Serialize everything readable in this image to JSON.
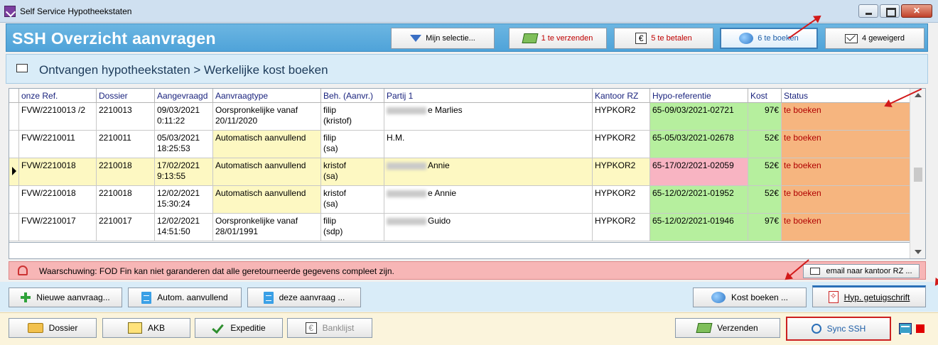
{
  "window": {
    "title": "Self Service Hypotheekstaten"
  },
  "header": {
    "title": "SSH  Overzicht aanvragen",
    "buttons": [
      {
        "label": "Mijn selectie...",
        "icon": "funnel-icon"
      },
      {
        "label": "1 te verzenden",
        "icon": "money-icon"
      },
      {
        "label": "5 te betalen",
        "icon": "euro-icon"
      },
      {
        "label": "6 te boeken",
        "icon": "gem-icon"
      },
      {
        "label": "4 geweigerd",
        "icon": "envelope-icon"
      }
    ]
  },
  "breadcrumb": "Ontvangen hypotheekstaten > Werkelijke kost boeken",
  "table": {
    "columns": [
      "onze Ref.",
      "Dossier",
      "Aangevraagd",
      "Aanvraagtype",
      "Beh. (Aanvr.)",
      "Partij 1",
      "Kantoor RZ",
      "Hypo-referentie",
      "Kost",
      "Status"
    ],
    "rows": [
      {
        "ref": "FVW/2210013 /2",
        "dossier": "2210013",
        "date": "09/03/2021",
        "time": "0:11:22",
        "type1": "Oorspronkelijke vanaf",
        "type2": "20/11/2020",
        "beh1": "filip",
        "beh2": "(kristof)",
        "partij": "e Marlies",
        "kantoor": "HYPKOR2",
        "hypo": "65-09/03/2021-02721",
        "kost": "97€",
        "status": "te boeken"
      },
      {
        "ref": "FVW/2210011",
        "dossier": "2210011",
        "date": "05/03/2021",
        "time": "18:25:53",
        "type1": "Automatisch aanvullend",
        "type2": "",
        "beh1": "filip",
        "beh2": "(sa)",
        "partij": "H.M.",
        "kantoor": "HYPKOR2",
        "hypo": "65-05/03/2021-02678",
        "kost": "52€",
        "status": "te boeken"
      },
      {
        "ref": "FVW/2210018",
        "dossier": "2210018",
        "date": "17/02/2021",
        "time": "9:13:55",
        "type1": "Automatisch aanvullend",
        "type2": "",
        "beh1": "kristof",
        "beh2": "(sa)",
        "partij": "Annie",
        "kantoor": "HYPKOR2",
        "hypo": "65-17/02/2021-02059",
        "kost": "52€",
        "status": "te boeken"
      },
      {
        "ref": "FVW/2210018",
        "dossier": "2210018",
        "date": "12/02/2021",
        "time": "15:30:24",
        "type1": "Automatisch aanvullend",
        "type2": "",
        "beh1": "kristof",
        "beh2": "(sa)",
        "partij": "e Annie",
        "kantoor": "HYPKOR2",
        "hypo": "65-12/02/2021-01952",
        "kost": "52€",
        "status": "te boeken"
      },
      {
        "ref": "FVW/2210017",
        "dossier": "2210017",
        "date": "12/02/2021",
        "time": "14:51:50",
        "type1": "Oorspronkelijke vanaf",
        "type2": "28/01/1991",
        "beh1": "filip",
        "beh2": "(sdp)",
        "partij": "Guido",
        "kantoor": "HYPKOR2",
        "hypo": "65-12/02/2021-01946",
        "kost": "97€",
        "status": "te boeken"
      }
    ]
  },
  "warning": {
    "text": "Waarschuwing: FOD Fin kan niet garanderen dat alle geretourneerde gegevens compleet zijn.",
    "button": "email naar kantoor RZ ..."
  },
  "actions": {
    "nieuwe": "Nieuwe aanvraag...",
    "autom": "Autom. aanvullend",
    "deze": "deze aanvraag ...",
    "kost": "Kost boeken ...",
    "hyp": "Hyp. getuigschrift"
  },
  "footer": {
    "dossier": "Dossier",
    "akb": "AKB",
    "expeditie": "Expeditie",
    "banklijst": "Banklijst",
    "verzenden": "Verzenden",
    "sync": "Sync SSH"
  },
  "colors": {
    "header": "#4fa3d9",
    "hypo_green": "#b6ef9e",
    "hypo_pink": "#f8b4c2",
    "status_orange": "#f6b57f",
    "row_selected": "#fdf8c2",
    "warning": "#f7b6b6"
  }
}
